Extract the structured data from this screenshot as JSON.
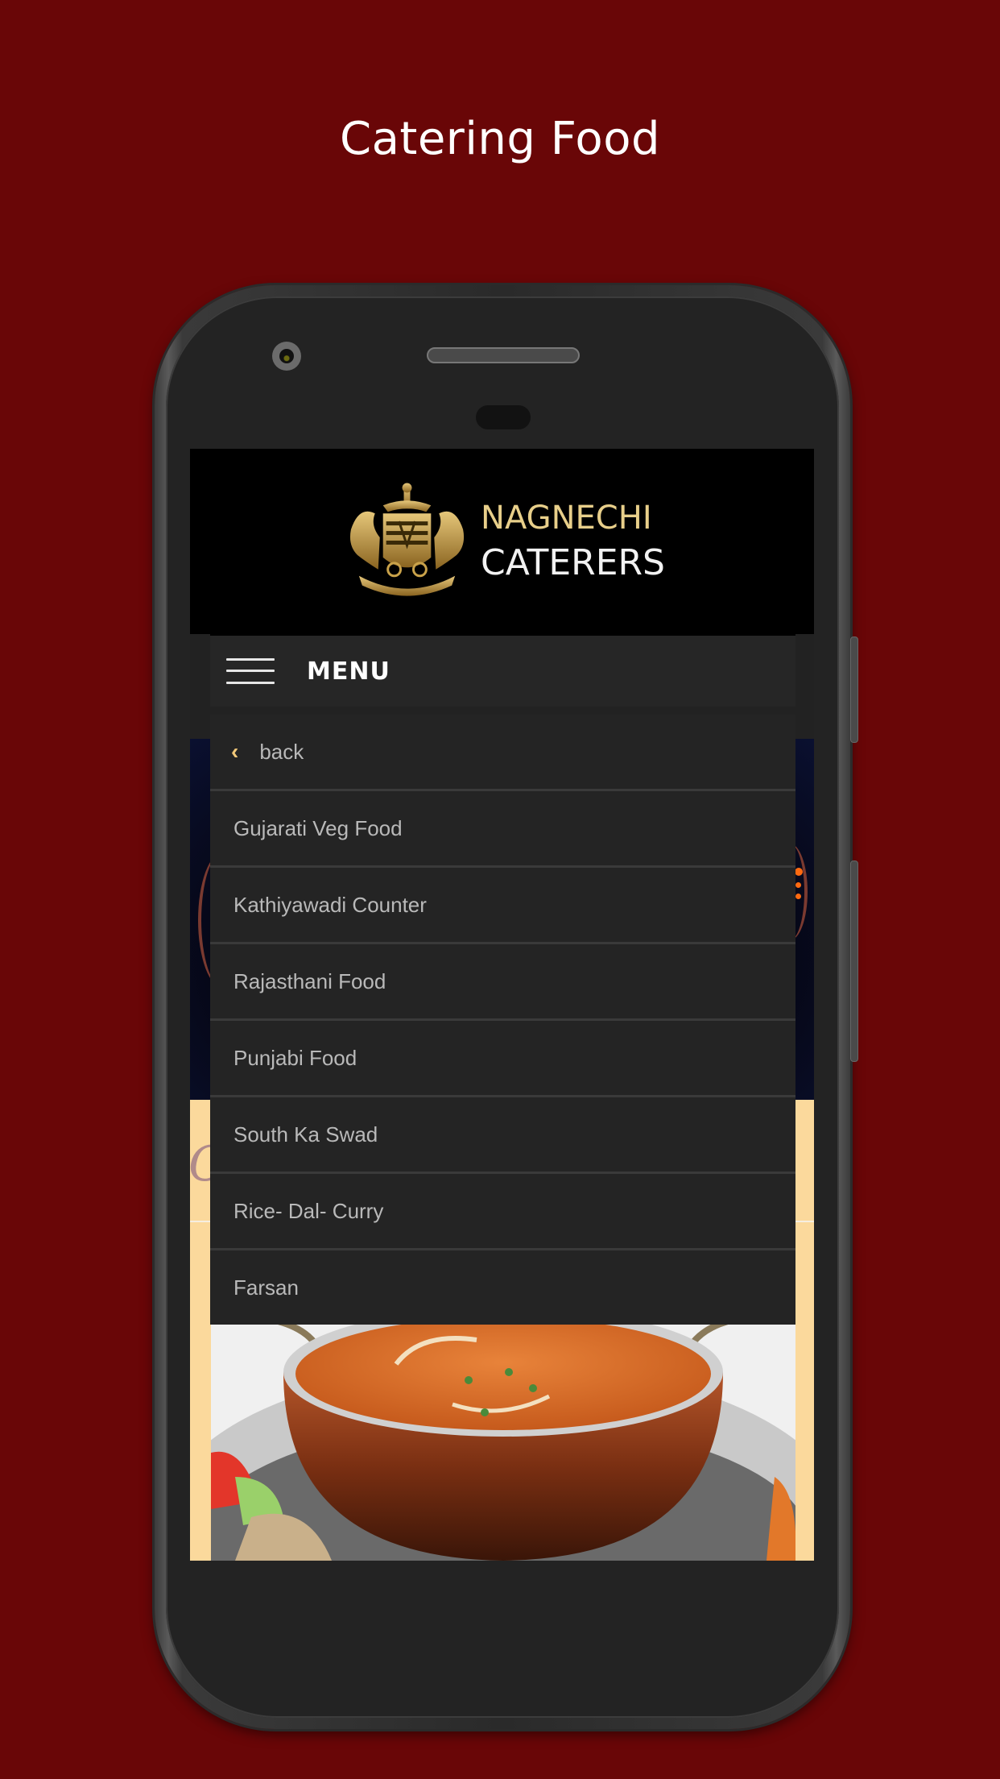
{
  "page": {
    "title": "Catering Food",
    "background_color": "#690607"
  },
  "app": {
    "brand": {
      "line1": "NAGNECHI",
      "line2": "CATERERS",
      "line1_color": "#e8cf8a",
      "line2_color": "#f2f2f2",
      "logo_icon": "royal-crest-icon"
    },
    "menu_bar": {
      "label": "MENU",
      "icon": "hamburger-icon"
    },
    "dropdown": {
      "back_label": "back",
      "back_icon": "chevron-left-icon",
      "accent_color": "#f2c97a",
      "items": [
        {
          "label": "Gujarati Veg Food"
        },
        {
          "label": "Kathiyawadi Counter"
        },
        {
          "label": "Rajasthani Food"
        },
        {
          "label": "Punjabi Food"
        },
        {
          "label": "South Ka Swad"
        },
        {
          "label": "Rice- Dal- Curry"
        },
        {
          "label": "Farsan"
        }
      ]
    },
    "content": {
      "section_script_letter": "C",
      "food_image": "curry-bowl-image"
    }
  }
}
